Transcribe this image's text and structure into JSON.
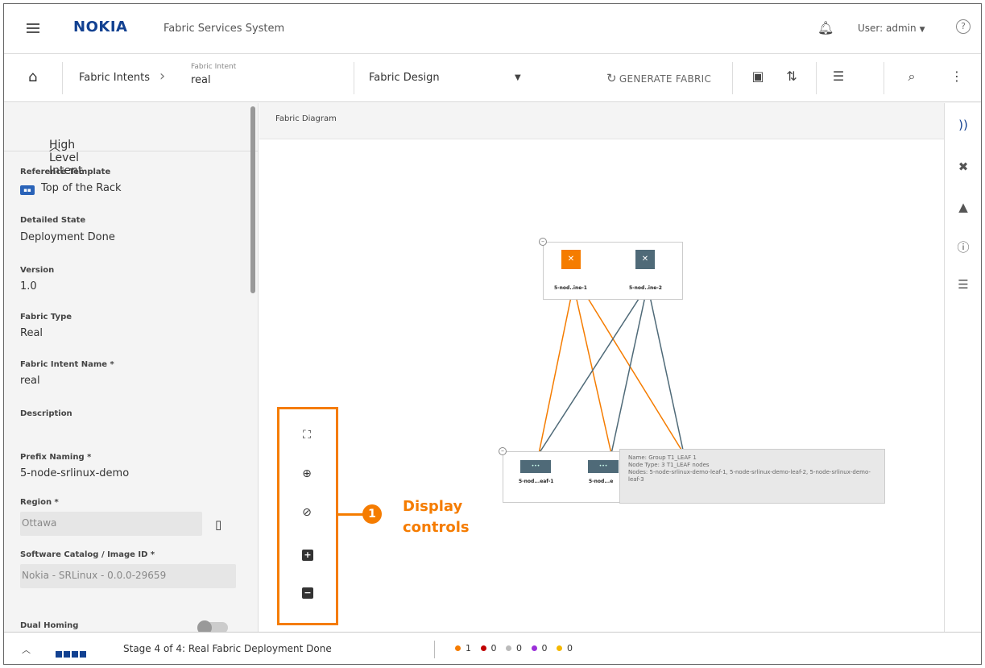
{
  "header": {
    "logo": "NOKIA",
    "app_title": "Fabric Services System",
    "user": "User: admin",
    "help": "?"
  },
  "toolbar": {
    "breadcrumb_root": "Fabric Intents",
    "crumb_label": "Fabric Intent",
    "crumb_value": "real",
    "view_select": "Fabric Design",
    "generate_label": "GENERATE FABRIC"
  },
  "left_panel": {
    "section_title": "High Level Intent",
    "fields": {
      "reference_template": {
        "label": "Reference Template",
        "value": "Top of the Rack"
      },
      "detailed_state": {
        "label": "Detailed State",
        "value": "Deployment Done"
      },
      "version": {
        "label": "Version",
        "value": "1.0"
      },
      "fabric_type": {
        "label": "Fabric Type",
        "value": "Real"
      },
      "fabric_intent_name": {
        "label": "Fabric Intent Name *",
        "value": "real"
      },
      "description": {
        "label": "Description",
        "value": ""
      },
      "prefix_naming": {
        "label": "Prefix Naming *",
        "value": "5-node-srlinux-demo"
      },
      "region": {
        "label": "Region *",
        "value": "Ottawa"
      },
      "software_catalog": {
        "label": "Software Catalog / Image ID *",
        "value": "Nokia - SRLinux - 0.0.0-29659"
      },
      "dual_homing": {
        "label": "Dual Homing",
        "value": false
      }
    }
  },
  "canvas": {
    "title": "Fabric Diagram",
    "spines": [
      {
        "label": "5-nod..ine-1",
        "color": "#f57c00"
      },
      {
        "label": "5-nod..ine-2",
        "color": "#4f6a78"
      }
    ],
    "leaves": [
      {
        "label": "5-nod...eaf-1"
      },
      {
        "label": "5-nod...e"
      }
    ],
    "tooltip": {
      "line1": "Name: Group T1_LEAF 1",
      "line2": "Node Type: 3 T1_LEAF nodes",
      "line3": "Nodes: 5-node-srlinux-demo-leaf-1, 5-node-srlinux-demo-leaf-2, 5-node-srlinux-demo-leaf-3"
    },
    "callout": {
      "number": "1",
      "line1": "Display",
      "line2": "controls"
    },
    "link_colors": {
      "active": "#f57c00",
      "inactive": "#4f6a78"
    }
  },
  "footer": {
    "stage": "Stage 4 of 4: Real Fabric Deployment Done",
    "status": [
      {
        "color": "#f57c00",
        "count": "1"
      },
      {
        "color": "#c00000",
        "count": "0"
      },
      {
        "color": "#bbbbbb",
        "count": "0"
      },
      {
        "color": "#9b30d9",
        "count": "0"
      },
      {
        "color": "#f5b800",
        "count": "0"
      }
    ]
  }
}
